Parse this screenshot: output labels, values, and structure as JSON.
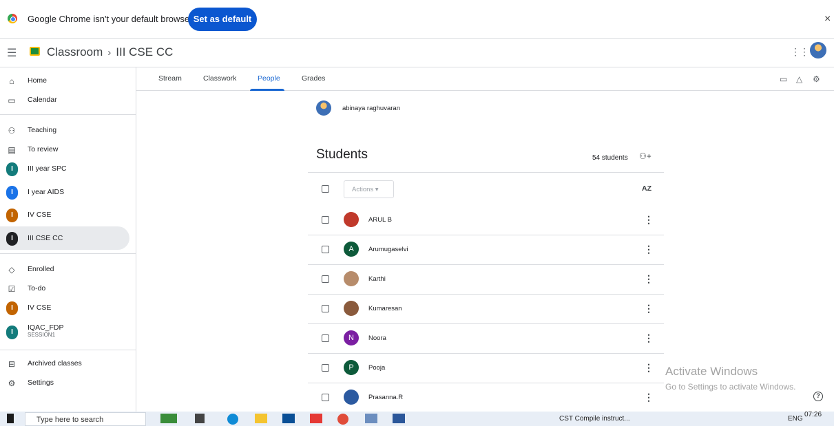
{
  "infobar": {
    "message": "Google Chrome isn't your default browser",
    "set_default": "Set as default",
    "close": "×"
  },
  "header": {
    "app_name": "Classroom",
    "separator": "›",
    "class_name": "III CSE CC"
  },
  "sidebar": {
    "items": [
      {
        "label": "Home",
        "icon": "home-icon"
      },
      {
        "label": "Calendar",
        "icon": "calendar-icon"
      },
      {
        "label": "Teaching",
        "icon": "people-icon"
      },
      {
        "label": "To review",
        "icon": "review-icon"
      },
      {
        "label": "III year SPC",
        "letter": "I",
        "color": "#137b7b"
      },
      {
        "label": "I year AIDS",
        "letter": "I",
        "color": "#1a73e8"
      },
      {
        "label": "IV CSE",
        "letter": "I",
        "color": "#c26401"
      },
      {
        "label": "III CSE CC",
        "letter": "I",
        "color": "#202124"
      },
      {
        "label": "Enrolled",
        "icon": "graduation-cap-icon"
      },
      {
        "label": "To-do",
        "icon": "todo-icon"
      },
      {
        "label": "IV CSE",
        "letter": "I",
        "color": "#c26401"
      },
      {
        "label": "IQAC_FDP",
        "sub": "SESSION1",
        "letter": "I",
        "color": "#137b7b"
      },
      {
        "label": "Archived classes",
        "icon": "archive-icon"
      },
      {
        "label": "Settings",
        "icon": "gear-icon"
      }
    ]
  },
  "tabs": [
    {
      "label": "Stream"
    },
    {
      "label": "Classwork"
    },
    {
      "label": "People",
      "active": true
    },
    {
      "label": "Grades"
    }
  ],
  "teacher": {
    "name": "abinaya raghuvaran"
  },
  "students": {
    "title": "Students",
    "count": "54 students",
    "actions_label": "Actions ▾",
    "sort_label": "AZ",
    "list": [
      {
        "name": "ARUL B",
        "avatar": "photo",
        "color": "#c0392b"
      },
      {
        "name": "Arumugaselvi",
        "avatar": "A",
        "color": "#0d5a3a"
      },
      {
        "name": "Karthi",
        "avatar": "photo",
        "color": "#b78c6b"
      },
      {
        "name": "Kumaresan",
        "avatar": "photo",
        "color": "#8a5a3c"
      },
      {
        "name": "Noora",
        "avatar": "N",
        "color": "#7b1fa2"
      },
      {
        "name": "Pooja",
        "avatar": "P",
        "color": "#0d5a3a"
      },
      {
        "name": "Prasanna.R",
        "avatar": "photo",
        "color": "#2c5aa0"
      }
    ]
  },
  "watermark": {
    "line1": "Activate Windows",
    "line2": "Go to Settings to activate Windows."
  },
  "taskbar": {
    "search_placeholder": "Type here to search",
    "tray_item": "CST Compile instruct...",
    "lang": "ENG",
    "time": "07:26"
  }
}
